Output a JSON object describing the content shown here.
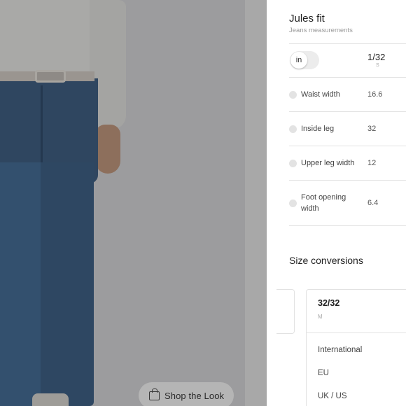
{
  "product": {
    "shop_look_label": "Shop the Look"
  },
  "panel": {
    "fit_title": "Jules fit",
    "fit_subtitle": "Jeans measurements",
    "unit_toggle": {
      "selected": "in"
    },
    "size_header": "1/32",
    "size_sub": "S",
    "measurements": [
      {
        "label": "Waist width",
        "value": "16.6"
      },
      {
        "label": "Inside leg",
        "value": "32"
      },
      {
        "label": "Upper leg width",
        "value": "12"
      },
      {
        "label": "Foot opening width",
        "value": "6.4"
      }
    ],
    "conversions": {
      "title": "Size conversions",
      "card": {
        "size": "32/32",
        "letter": "M",
        "rows": [
          "International",
          "EU",
          "UK / US"
        ]
      }
    }
  }
}
